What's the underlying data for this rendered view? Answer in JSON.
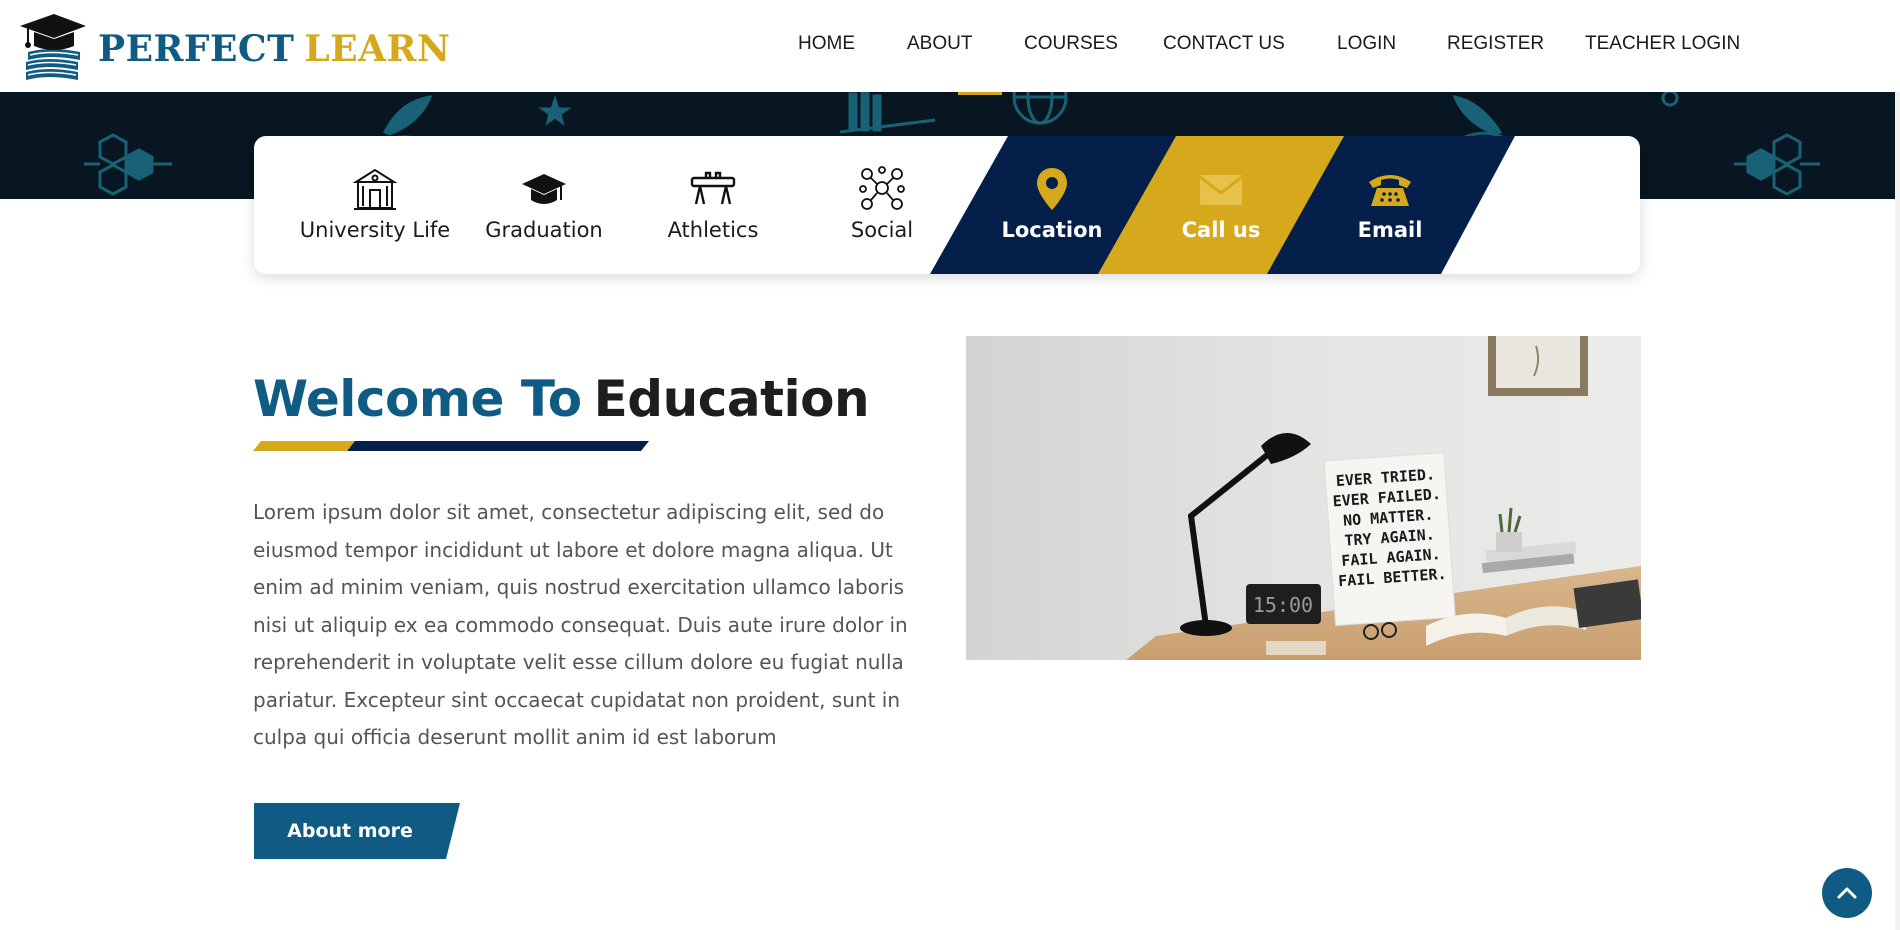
{
  "header": {
    "brand_part1": "PERFECT",
    "brand_part2": "LEARN",
    "nav": [
      "HOME",
      "ABOUT",
      "COURSES",
      "CONTACT US",
      "LOGIN",
      "REGISTER",
      "TEACHER LOGIN"
    ]
  },
  "features": [
    {
      "label": "University Life",
      "icon": "university-building-icon"
    },
    {
      "label": "Graduation",
      "icon": "graduation-cap-icon"
    },
    {
      "label": "Athletics",
      "icon": "pommel-horse-icon"
    },
    {
      "label": "Social",
      "icon": "social-network-icon"
    },
    {
      "label": "Location",
      "icon": "map-pin-icon"
    },
    {
      "label": "Call us",
      "icon": "envelope-icon"
    },
    {
      "label": "Email",
      "icon": "telephone-icon"
    }
  ],
  "welcome": {
    "title_part1": "Welcome To",
    "title_part2": "Education",
    "paragraph_lines": [
      "Lorem ipsum dolor sit amet, consectetur adipiscing elit, sed do",
      "eiusmod tempor incididunt ut labore et dolore magna aliqua. Ut",
      "enim ad minim veniam, quis nostrud exercitation ullamco laboris",
      "nisi ut aliquip ex ea commodo consequat. Duis aute irure dolor in",
      "reprehenderit in voluptate velit esse cillum dolore eu fugiat nulla",
      "pariatur. Excepteur sint occaecat cupidatat non proident, sunt in",
      "culpa qui officia deserunt mollit anim id est laborum"
    ],
    "button_label": "About more"
  },
  "photo": {
    "poster_lines": [
      "EVER TRIED.",
      "EVER FAILED.",
      "NO MATTER.",
      "TRY AGAIN.",
      "FAIL AGAIN.",
      "FAIL BETTER."
    ],
    "clock": "15:00"
  },
  "colors": {
    "primary_blue": "#0f5b84",
    "navy": "#04204a",
    "gold": "#d6a91c",
    "banner_dark": "#071620"
  }
}
